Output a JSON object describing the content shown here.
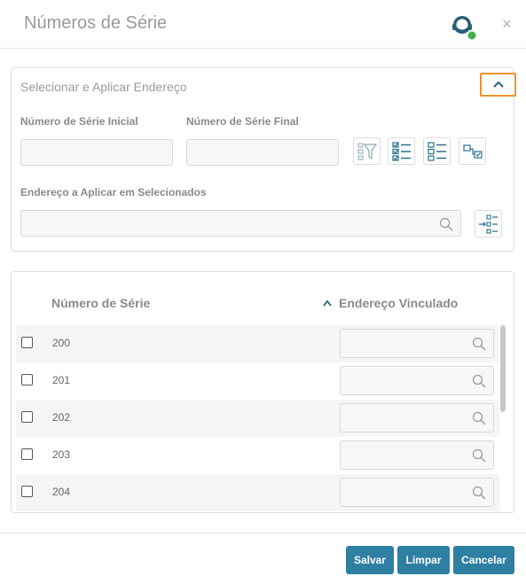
{
  "header": {
    "title": "Números de Série",
    "icons": {
      "support": "headset-support-icon",
      "close": "close-icon"
    },
    "close_glyph": "×"
  },
  "address_panel": {
    "title": "Selecionar e Aplicar Endereço",
    "start_serial_label": "Número de Série Inicial",
    "end_serial_label": "Número de Série Final",
    "start_serial_value": "",
    "end_serial_value": "",
    "address_label": "Endereço a Aplicar em Selecionados",
    "address_value": "",
    "tool_icons": [
      "filter-list-icon",
      "select-all-list-icon",
      "deselect-list-icon",
      "link-selected-icon",
      "apply-address-icon"
    ],
    "accent_color": "#f0932b"
  },
  "grid": {
    "columns": [
      "Número de Série",
      "Endereço Vinculado"
    ],
    "rows": [
      {
        "serial": "200",
        "address": ""
      },
      {
        "serial": "201",
        "address": ""
      },
      {
        "serial": "202",
        "address": ""
      },
      {
        "serial": "203",
        "address": ""
      },
      {
        "serial": "204",
        "address": ""
      }
    ]
  },
  "footer": {
    "save_label": "Salvar",
    "clear_label": "Limpar",
    "cancel_label": "Cancelar",
    "button_color": "#2f7fa3"
  }
}
